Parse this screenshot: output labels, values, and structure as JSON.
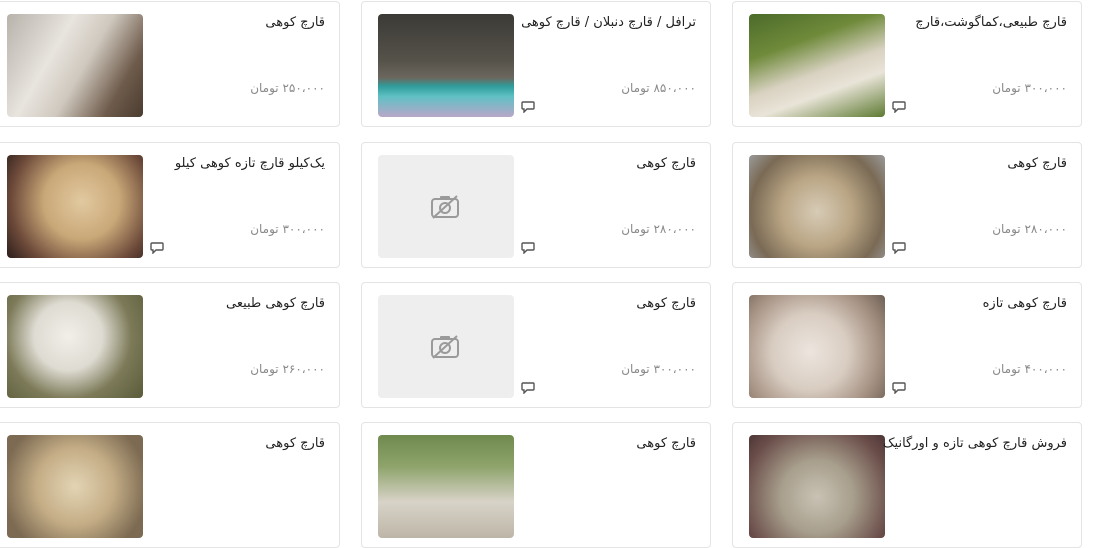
{
  "listings": [
    {
      "title": "قارچ طبیعی،کماگوشت،قارچ",
      "price": "۳۰۰،۰۰۰ تومان",
      "has_chat": true,
      "image": "photo"
    },
    {
      "title": "ترافل / قارچ دنبلان / قارچ کوهی",
      "price": "۸۵۰،۰۰۰ تومان",
      "has_chat": true,
      "image": "photo"
    },
    {
      "title": "قارچ کوهی",
      "price": "۲۵۰،۰۰۰ تومان",
      "has_chat": false,
      "image": "photo"
    },
    {
      "title": "قارچ کوهی",
      "price": "۲۸۰،۰۰۰ تومان",
      "has_chat": true,
      "image": "photo"
    },
    {
      "title": "قارچ کوهی",
      "price": "۲۸۰،۰۰۰ تومان",
      "has_chat": true,
      "image": "placeholder"
    },
    {
      "title": "یک‌کیلو قارچ تازه کوهی کیلو",
      "price": "۳۰۰،۰۰۰ تومان",
      "has_chat": true,
      "image": "photo"
    },
    {
      "title": "قارچ کوهی تازه",
      "price": "۴۰۰،۰۰۰ تومان",
      "has_chat": true,
      "image": "photo"
    },
    {
      "title": "قارچ کوهی",
      "price": "۳۰۰،۰۰۰ تومان",
      "has_chat": true,
      "image": "placeholder"
    },
    {
      "title": "قارچ کوهی طبیعی",
      "price": "۲۶۰،۰۰۰ تومان",
      "has_chat": false,
      "image": "photo"
    },
    {
      "title": "فروش قارچ کوهی تازه و اورگانیک",
      "price": "",
      "has_chat": false,
      "image": "photo"
    },
    {
      "title": "قارچ کوهی",
      "price": "",
      "has_chat": false,
      "image": "photo"
    },
    {
      "title": "قارچ کوهی",
      "price": "",
      "has_chat": false,
      "image": "photo"
    }
  ]
}
